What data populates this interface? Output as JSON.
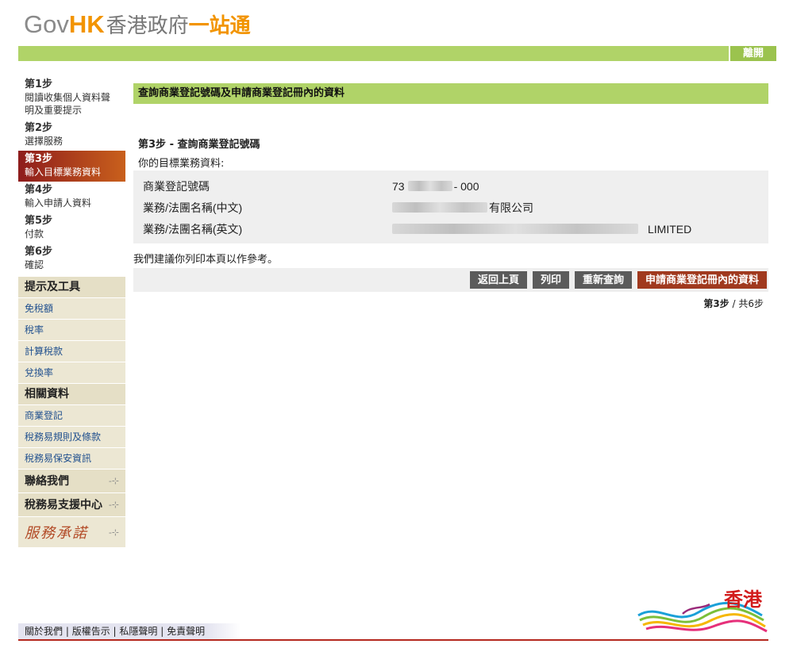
{
  "header": {
    "logo_gov": "Gov",
    "logo_hk": "HK",
    "logo_zh": "香港政府",
    "logo_zh_accent": "一站通",
    "exit_label": "離開"
  },
  "sidebar": {
    "steps": [
      {
        "num": "第1步",
        "text": "閱讀收集個人資料聲明及重要提示"
      },
      {
        "num": "第2步",
        "text": "選擇服務"
      },
      {
        "num": "第3步",
        "text": "輸入目標業務資料"
      },
      {
        "num": "第4步",
        "text": "輸入申請人資料"
      },
      {
        "num": "第5步",
        "text": "付款"
      },
      {
        "num": "第6步",
        "text": "確認"
      }
    ],
    "tips_heading": "提示及工具",
    "tips_links": [
      "免稅額",
      "稅率",
      "計算稅款",
      "兌換率"
    ],
    "related_heading": "相關資料",
    "related_links": [
      "商業登記",
      "稅務易規則及條款",
      "稅務易保安資訊"
    ],
    "contact_heading": "聯絡我們",
    "support_heading": "稅務易支援中心",
    "promise_label": "服務承諾"
  },
  "main": {
    "title": "查詢商業登記號碼及申請商業登記冊內的資料",
    "section_title": "第3步 - 查詢商業登記號碼",
    "subtitle": "你的目標業務資料:",
    "fields": [
      {
        "label": "商業登記號碼",
        "value_prefix": "73",
        "value_suffix": "- 000"
      },
      {
        "label": "業務/法團名稱(中文)",
        "value_prefix": "",
        "value_suffix": "有限公司"
      },
      {
        "label": "業務/法團名稱(英文)",
        "value_prefix": "",
        "value_suffix": "LIMITED"
      }
    ],
    "note": "我們建議你列印本頁以作參考。",
    "buttons": {
      "back": "返回上頁",
      "print": "列印",
      "reset": "重新查詢",
      "apply": "申請商業登記冊內的資料"
    },
    "step_current": "第3步",
    "step_total": " / 共6步"
  },
  "footer": {
    "links": [
      "關於我們",
      "版權告示",
      "私隱聲明",
      "免責聲明"
    ],
    "separator": " | ",
    "brand_text": "香港"
  }
}
